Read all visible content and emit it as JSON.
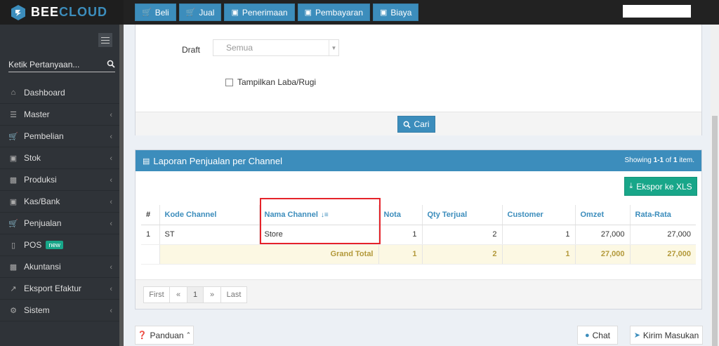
{
  "brand": {
    "part1": "BEE",
    "part2": "CLOUD"
  },
  "topnav": [
    {
      "label": "Beli",
      "icon": "cart-icon"
    },
    {
      "label": "Jual",
      "icon": "cart-icon"
    },
    {
      "label": "Penerimaan",
      "icon": "money-icon"
    },
    {
      "label": "Pembayaran",
      "icon": "money-icon"
    },
    {
      "label": "Biaya",
      "icon": "money-icon"
    }
  ],
  "sidebar": {
    "search_placeholder": "Ketik Pertanyaan...",
    "items": [
      {
        "label": "Dashboard",
        "icon": "home-icon"
      },
      {
        "label": "Master",
        "icon": "database-icon"
      },
      {
        "label": "Pembelian",
        "icon": "cart-icon"
      },
      {
        "label": "Stok",
        "icon": "box-icon"
      },
      {
        "label": "Produksi",
        "icon": "industry-icon"
      },
      {
        "label": "Kas/Bank",
        "icon": "money-icon"
      },
      {
        "label": "Penjualan",
        "icon": "cart-icon"
      },
      {
        "label": "POS",
        "icon": "desktop-icon",
        "badge": "new"
      },
      {
        "label": "Akuntansi",
        "icon": "bar-chart-icon"
      },
      {
        "label": "Eksport Efaktur",
        "icon": "export-icon"
      },
      {
        "label": "Sistem",
        "icon": "cogs-icon"
      }
    ]
  },
  "filter": {
    "draft_label": "Draft",
    "draft_value": "Semua",
    "checkbox_label": "Tampilkan Laba/Rugi",
    "search_button": "Cari"
  },
  "report": {
    "title": "Laporan Penjualan per Channel",
    "showing_prefix": "Showing ",
    "showing_range": "1-1",
    "showing_of": " of ",
    "showing_total": "1",
    "showing_suffix": " item.",
    "export_button": "Ekspor ke XLS",
    "columns": [
      "#",
      "Kode Channel",
      "Nama Channel",
      "Nota",
      "Qty Terjual",
      "Customer",
      "Omzet",
      "Rata-Rata"
    ],
    "rows": [
      {
        "no": "1",
        "kode": "ST",
        "nama": "Store",
        "nota": "1",
        "qty": "2",
        "customer": "1",
        "omzet": "27,000",
        "rata": "27,000"
      }
    ],
    "total": {
      "label": "Grand Total",
      "nota": "1",
      "qty": "2",
      "customer": "1",
      "omzet": "27,000",
      "rata": "27,000"
    }
  },
  "pager": {
    "first": "First",
    "prev": "«",
    "current": "1",
    "next": "»",
    "last": "Last"
  },
  "footer": {
    "panduan": "Panduan",
    "chat": "Chat",
    "kirim": "Kirim Masukan"
  },
  "colors": {
    "primary": "#3c8dbc",
    "success": "#18a689",
    "highlight": "#e5232a",
    "sidebar_bg": "#2f3338"
  }
}
